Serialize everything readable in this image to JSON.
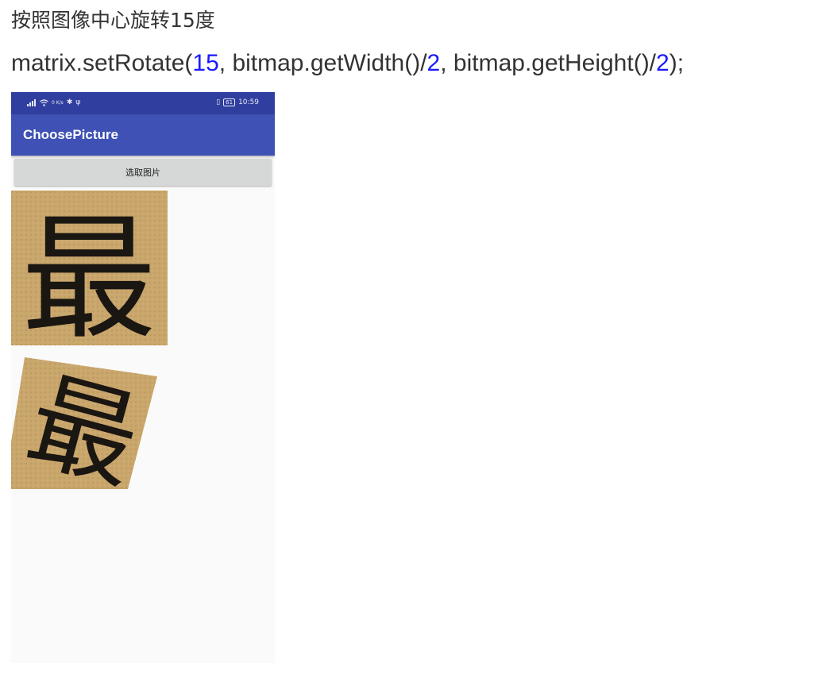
{
  "heading": "按照图像中心旋转15度",
  "code": {
    "prefix": "matrix.setRotate(",
    "angle": "15",
    "mid1": ", bitmap.getWidth()/",
    "div1": "2",
    "mid2": ", bitmap.getHeight()/",
    "div2": "2",
    "suffix": ");"
  },
  "phone": {
    "status_bar": {
      "left_icons": [
        "signal-icon",
        "wifi-icon",
        "netspeed-icon",
        "bluetooth-icon",
        "usb-icon"
      ],
      "netspeed": "0 K/s",
      "battery": "61",
      "time": "10:59"
    },
    "app_title": "ChoosePicture",
    "button_label": "选取图片",
    "images": {
      "original_glyph": "最",
      "rotated_glyph": "最",
      "rotation_degrees": 15
    },
    "colors": {
      "status_bar": "#303f9f",
      "app_bar": "#3f51b5",
      "paper": "#c9a66b",
      "ink": "#1a1612"
    }
  }
}
